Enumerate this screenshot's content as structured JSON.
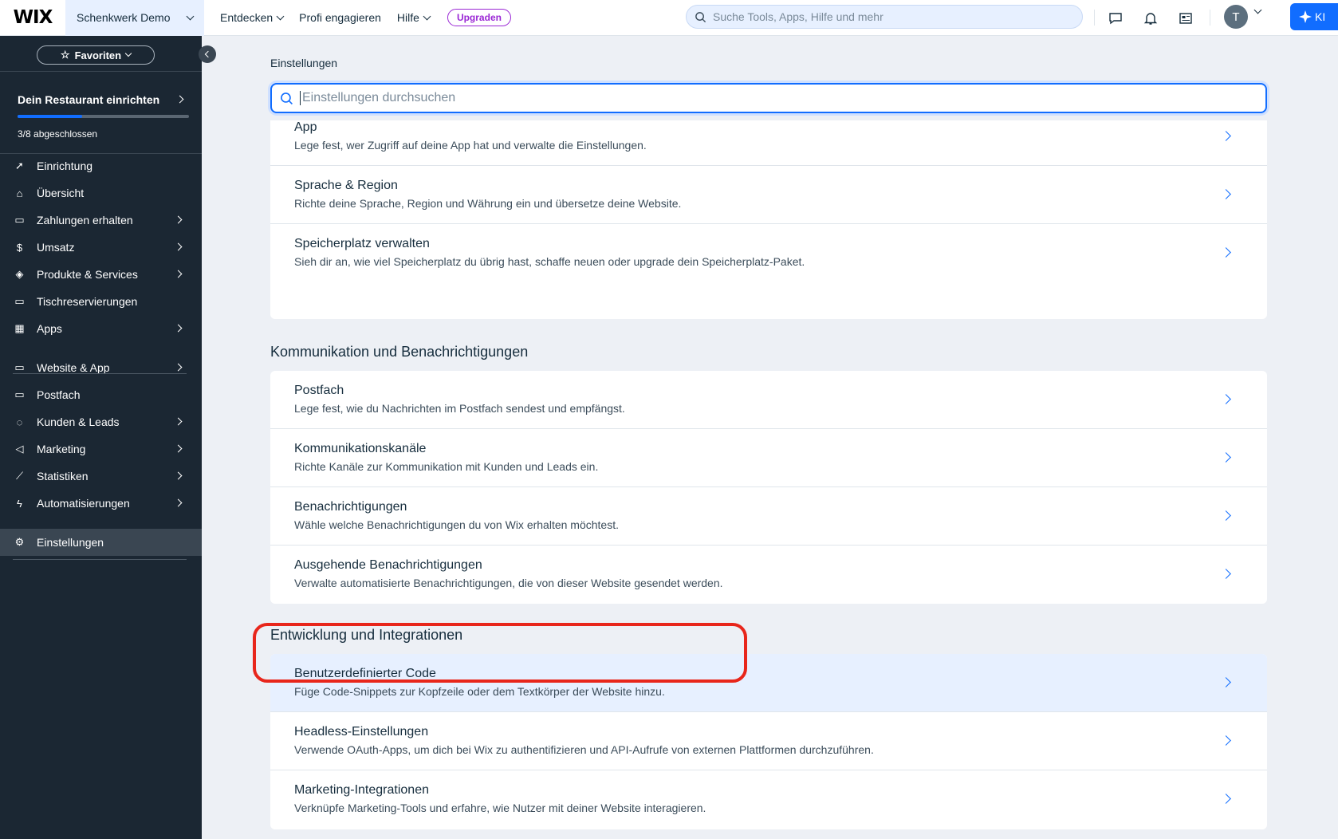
{
  "topbar": {
    "logo": "WIX",
    "site_name": "Schenkwerk Demo",
    "nav": [
      "Entdecken",
      "Profi engagieren",
      "Hilfe"
    ],
    "upgrade_label": "Upgraden",
    "search_placeholder": "Suche Tools, Apps, Hilfe und mehr",
    "avatar_initial": "T",
    "ai_label": "KI",
    "icons": [
      "chat-icon",
      "bell-icon",
      "news-icon"
    ]
  },
  "sidebar": {
    "favorites_label": "Favoriten",
    "setup_title": "Dein Restaurant einrichten",
    "setup_progress": "3/8 abgeschlossen",
    "setup_progress_fraction": 0.375,
    "items": [
      {
        "label": "Einrichtung",
        "icon": "rocket-icon",
        "arrow": false
      },
      {
        "label": "Übersicht",
        "icon": "home-icon",
        "arrow": false
      },
      {
        "label": "Zahlungen erhalten",
        "icon": "payment-icon",
        "arrow": true
      },
      {
        "label": "Umsatz",
        "icon": "dollar-icon",
        "arrow": true
      },
      {
        "label": "Produkte & Services",
        "icon": "products-icon",
        "arrow": true
      },
      {
        "label": "Tischreservierungen",
        "icon": "table-icon",
        "arrow": false
      },
      {
        "label": "Apps",
        "icon": "apps-icon",
        "arrow": true
      },
      {
        "label": "Website & App",
        "icon": "website-icon",
        "arrow": true
      },
      {
        "label": "Postfach",
        "icon": "inbox-icon",
        "arrow": false
      },
      {
        "label": "Kunden & Leads",
        "icon": "contacts-icon",
        "arrow": true
      },
      {
        "label": "Marketing",
        "icon": "megaphone-icon",
        "arrow": true
      },
      {
        "label": "Statistiken",
        "icon": "chart-icon",
        "arrow": true
      },
      {
        "label": "Automatisierungen",
        "icon": "lightning-icon",
        "arrow": true
      },
      {
        "label": "Einstellungen",
        "icon": "gear-icon",
        "arrow": false,
        "active": true
      }
    ]
  },
  "main": {
    "title": "Einstellungen",
    "search_placeholder": "Einstellungen durchsuchen",
    "top_card": [
      {
        "title": "App",
        "desc": "Lege fest, wer Zugriff auf deine App hat und verwalte die Einstellungen."
      },
      {
        "title": "Sprache & Region",
        "desc": "Richte deine Sprache, Region und Währung ein und übersetze deine Website."
      },
      {
        "title": "Speicherplatz verwalten",
        "desc": "Sieh dir an, wie viel Speicherplatz du übrig hast, schaffe neuen oder upgrade dein Speicherplatz-Paket."
      }
    ],
    "sections": [
      {
        "title": "Kommunikation und Benachrichtigungen",
        "rows": [
          {
            "title": "Postfach",
            "desc": "Lege fest, wie du Nachrichten im Postfach sendest und empfängst."
          },
          {
            "title": "Kommunikationskanäle",
            "desc": "Richte Kanäle zur Kommunikation mit Kunden und Leads ein."
          },
          {
            "title": "Benachrichtigungen",
            "desc": "Wähle welche Benachrichtigungen du von Wix erhalten möchtest."
          },
          {
            "title": "Ausgehende Benachrichtigungen",
            "desc": "Verwalte automatisierte Benachrichtigungen, die von dieser Website gesendet werden."
          }
        ]
      },
      {
        "title": "Entwicklung und Integrationen",
        "rows": [
          {
            "title": "Benutzerdefinierter Code",
            "desc": "Füge Code-Snippets zur Kopfzeile oder dem Textkörper der Website hinzu.",
            "highlight": true
          },
          {
            "title": "Headless-Einstellungen",
            "desc": "Verwende OAuth-Apps, um dich bei Wix zu authentifizieren und API-Aufrufe von externen Plattformen durchzuführen."
          },
          {
            "title": "Marketing-Integrationen",
            "desc": "Verknüpfe Marketing-Tools und erfahre, wie Nutzer mit deiner Website interagieren."
          }
        ]
      }
    ]
  },
  "colors": {
    "accent": "#116dff",
    "sidebar_bg": "#1b2733",
    "annotation": "#e8261b",
    "upgrade": "#9a27d5"
  }
}
